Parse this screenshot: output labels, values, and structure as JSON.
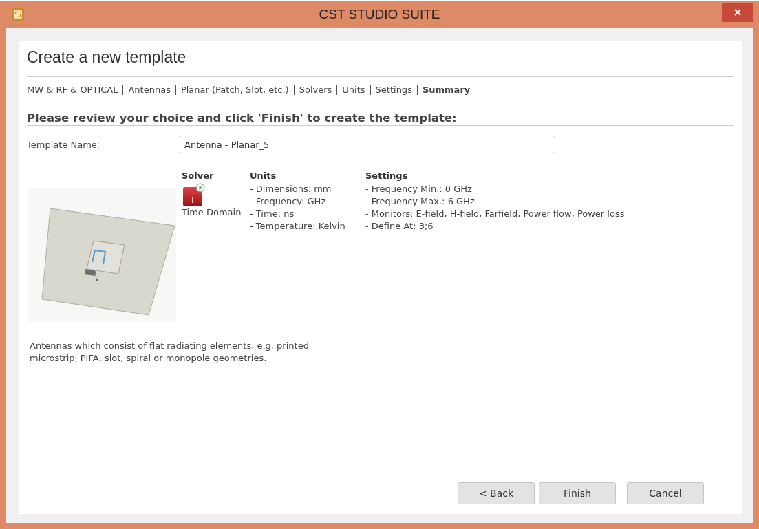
{
  "window": {
    "title": "CST STUDIO SUITE"
  },
  "heading": "Create a new template",
  "breadcrumb": [
    {
      "label": "MW & RF & OPTICAL",
      "selected": false
    },
    {
      "label": "Antennas",
      "selected": false
    },
    {
      "label": "Planar (Patch, Slot, etc.)",
      "selected": false
    },
    {
      "label": "Solvers",
      "selected": false
    },
    {
      "label": "Units",
      "selected": false
    },
    {
      "label": "Settings",
      "selected": false
    },
    {
      "label": "Summary",
      "selected": true
    }
  ],
  "section_title": "Please review your choice and click 'Finish' to create the template:",
  "template_name": {
    "label": "Template Name:",
    "value": "Antenna - Planar_5"
  },
  "solver": {
    "heading": "Solver",
    "name": "Time Domain",
    "icon_letter": "T"
  },
  "units": {
    "heading": "Units",
    "items": [
      "- Dimensions: mm",
      "- Frequency: GHz",
      "- Time: ns",
      "- Temperature: Kelvin"
    ]
  },
  "settings": {
    "heading": "Settings",
    "items": [
      "- Frequency Min.: 0 GHz",
      "- Frequency Max.: 6 GHz",
      "- Monitors: E-field, H-field, Farfield, Power flow, Power loss",
      "- Define At: 3;6"
    ]
  },
  "description": "Antennas which consist of flat radiating elements, e.g. printed microstrip, PIFA, slot, spiral or monopole geometries.",
  "buttons": [
    "< Back",
    "Finish",
    "Cancel"
  ]
}
